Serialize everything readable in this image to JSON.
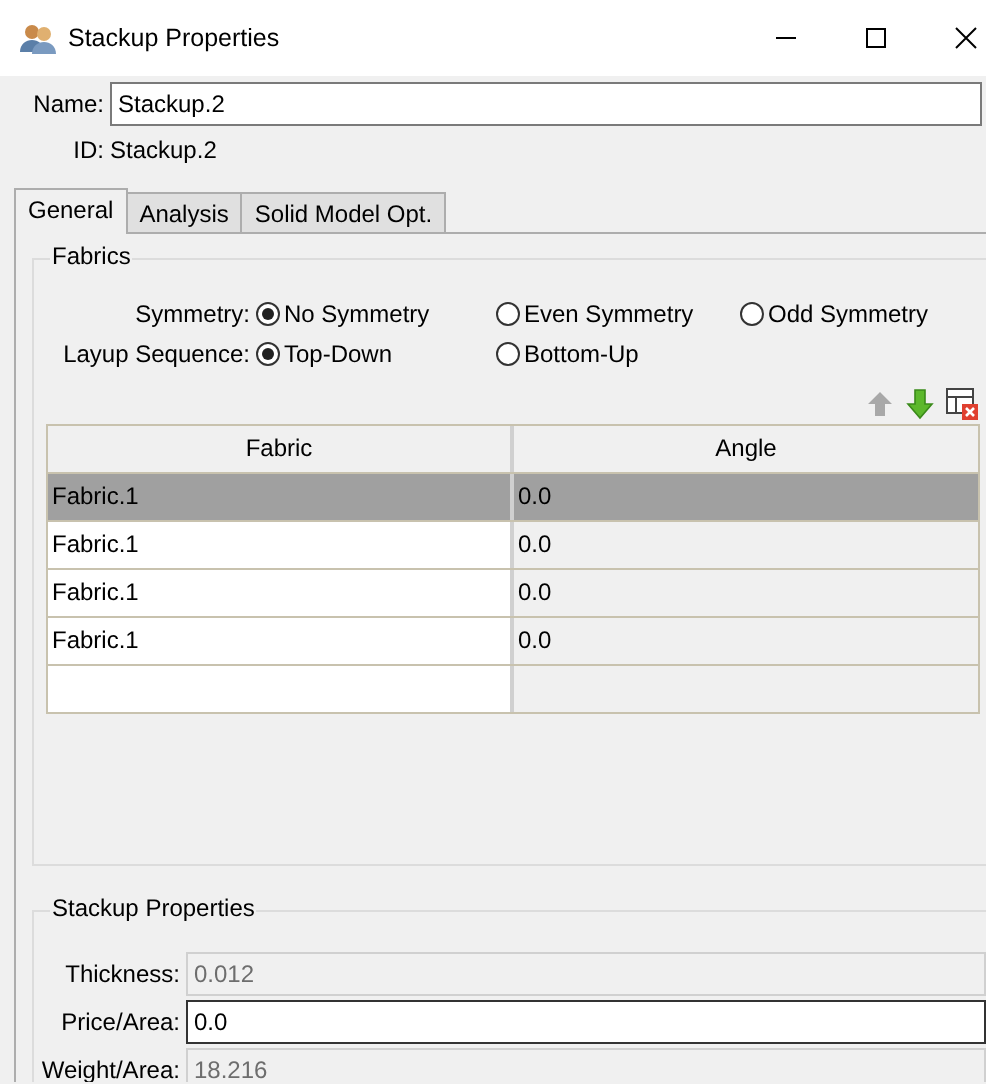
{
  "window": {
    "title": "Stackup Properties"
  },
  "name": {
    "label": "Name:",
    "value": "Stackup.2"
  },
  "id": {
    "label": "ID:",
    "value": "Stackup.2"
  },
  "tabs": [
    {
      "label": "General",
      "selected": true
    },
    {
      "label": "Analysis",
      "selected": false
    },
    {
      "label": "Solid Model Opt.",
      "selected": false
    }
  ],
  "fabrics": {
    "title": "Fabrics",
    "radio_groups": [
      {
        "label": "Symmetry:",
        "options": [
          {
            "label": "No Symmetry",
            "selected": true
          },
          {
            "label": "Even Symmetry",
            "selected": false
          },
          {
            "label": "Odd Symmetry",
            "selected": false
          }
        ]
      },
      {
        "label": "Layup Sequence:",
        "options": [
          {
            "label": "Top-Down",
            "selected": true
          },
          {
            "label": "Bottom-Up",
            "selected": false
          }
        ]
      }
    ],
    "toolbar": [
      {
        "kind": "up",
        "disabled": true
      },
      {
        "kind": "down",
        "disabled": false
      },
      {
        "kind": "delete",
        "disabled": false
      }
    ],
    "table": {
      "columns": [
        "Fabric",
        "Angle"
      ],
      "rows": [
        {
          "cells": [
            "Fabric.1",
            "0.0"
          ],
          "selected": true
        },
        {
          "cells": [
            "Fabric.1",
            "0.0"
          ],
          "selected": false
        },
        {
          "cells": [
            "Fabric.1",
            "0.0"
          ],
          "selected": false
        },
        {
          "cells": [
            "Fabric.1",
            "0.0"
          ],
          "selected": false
        }
      ]
    }
  },
  "stackup_properties": {
    "title": "Stackup Properties",
    "fields": [
      {
        "label": "Thickness:",
        "value": "0.012",
        "disabled": true
      },
      {
        "label": "Price/Area:",
        "value": "0.0",
        "disabled": false
      },
      {
        "label": "Weight/Area:",
        "value": "18.216",
        "disabled": true
      }
    ]
  }
}
